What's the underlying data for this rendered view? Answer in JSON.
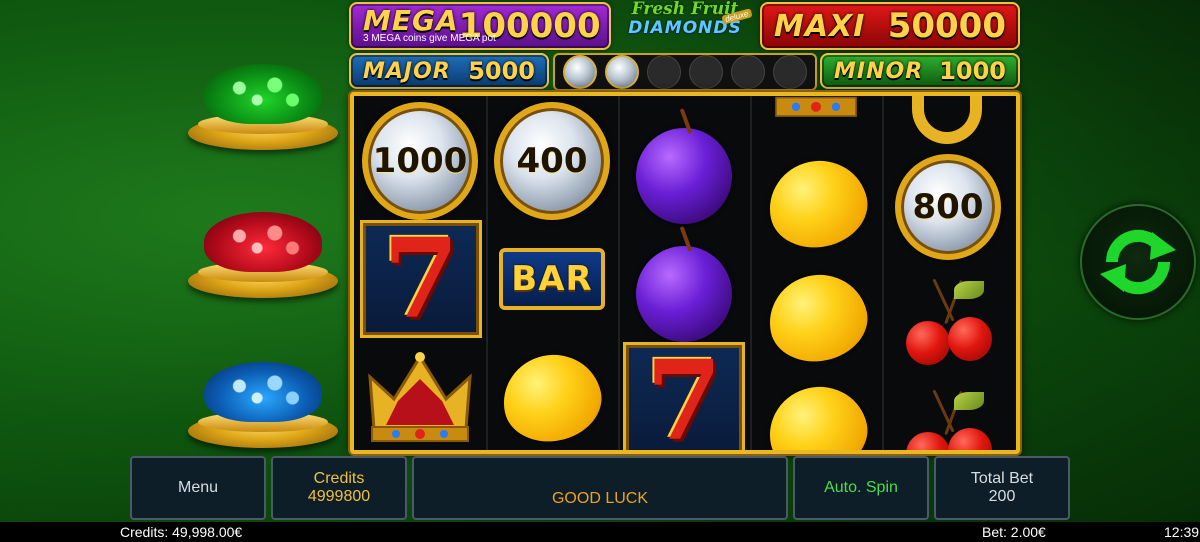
{
  "jackpots": {
    "mega": {
      "name": "MEGA",
      "value": "100000",
      "subtitle": "3 MEGA coins give MEGA pot"
    },
    "maxi": {
      "name": "MAXI",
      "value": "50000"
    },
    "major": {
      "name": "MAJOR",
      "value": "5000"
    },
    "minor": {
      "name": "MINOR",
      "value": "1000"
    }
  },
  "logo": {
    "line1": "Fresh Fruit",
    "line2": "DIAMONDS",
    "badge": "deluxe"
  },
  "coin_progress": {
    "collected": 2,
    "total": 6
  },
  "reels": {
    "reel1": [
      "1000",
      "7",
      "crown"
    ],
    "reel2": [
      "400",
      "BAR",
      "lemon"
    ],
    "reel3": [
      "plum",
      "plum",
      "7"
    ],
    "reel4": [
      "crown",
      "lemon",
      "lemon",
      "lemon"
    ],
    "reel5": [
      "horseshoe",
      "800",
      "cherries",
      "cherries"
    ]
  },
  "coin_values": {
    "r1c1": "1000",
    "r2c1": "400",
    "r5c2": "800"
  },
  "bar_label": "BAR",
  "seven_label": "7",
  "pots": [
    "emerald-pot",
    "ruby-pot",
    "sapphire-pot"
  ],
  "controls": {
    "menu": "Menu",
    "credits_label": "Credits",
    "credits_value": "4999800",
    "message": "GOOD LUCK",
    "auto_spin": "Auto. Spin",
    "total_bet_label": "Total Bet",
    "total_bet_value": "200"
  },
  "status": {
    "credits": "Credits: 49,998.00€",
    "bet": "Bet: 2.00€",
    "time": "12:39"
  },
  "colors": {
    "gold": "#e7b224",
    "mega": "#7a1fb0",
    "maxi": "#c01010",
    "major": "#1a5aa0",
    "minor": "#1a8a1a"
  }
}
